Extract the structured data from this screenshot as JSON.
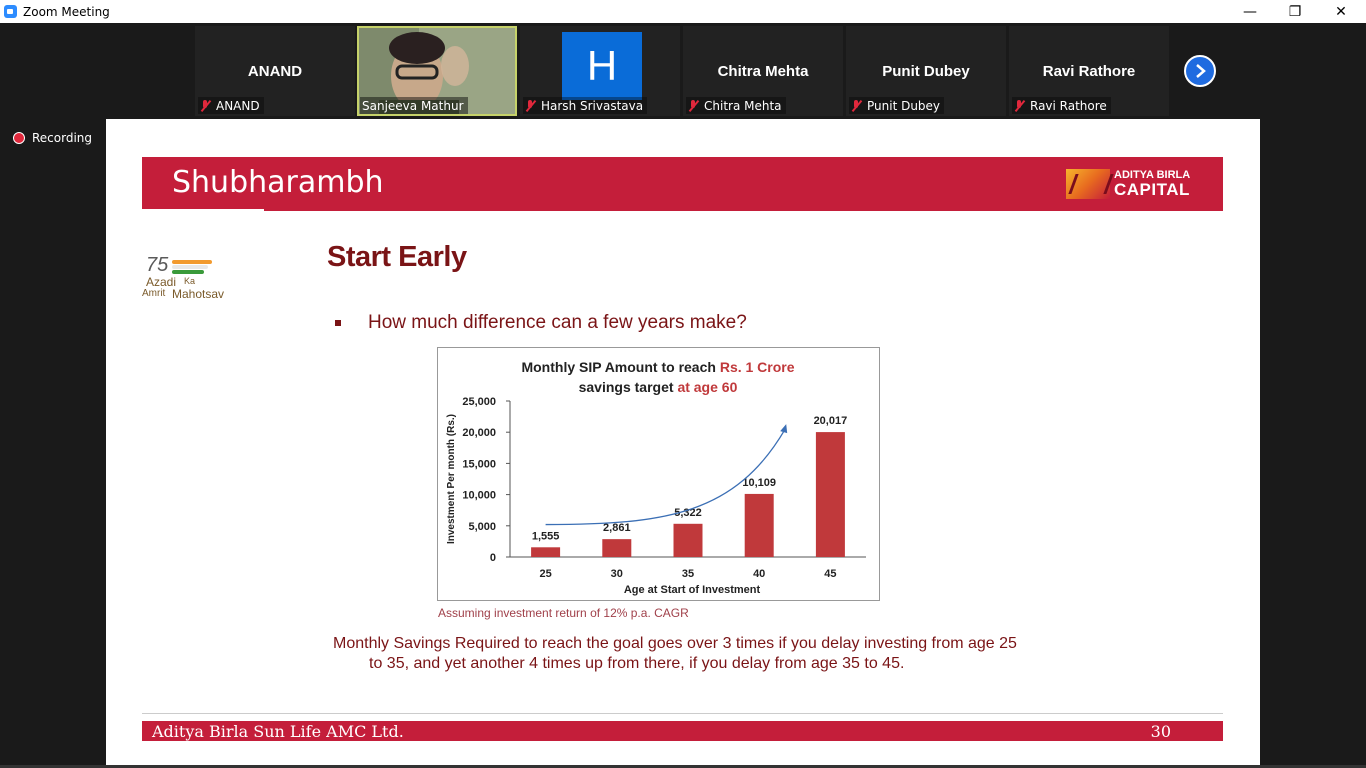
{
  "window": {
    "title": "Zoom Meeting",
    "minimize": "—",
    "restore": "❐",
    "close": "✕"
  },
  "participants": [
    {
      "name": "ANAND",
      "display": "ANAND",
      "type": "name"
    },
    {
      "name": "Sanjeeva Mathur",
      "display": "",
      "type": "video"
    },
    {
      "name": "Harsh Srivastava",
      "display": "H",
      "type": "avatar"
    },
    {
      "name": "Chitra Mehta",
      "display": "Chitra Mehta",
      "type": "name"
    },
    {
      "name": "Punit Dubey",
      "display": "Punit Dubey",
      "type": "name"
    },
    {
      "name": "Ravi Rathore",
      "display": "Ravi Rathore",
      "type": "name"
    }
  ],
  "recording": {
    "label": "Recording"
  },
  "slide": {
    "header_title": "Shubharambh",
    "logo_top": "ADITYA BIRLA",
    "logo_bottom": "CAPITAL",
    "azadi": {
      "n": "75",
      "line1": "Azadi",
      "ka": "Ka",
      "amrit": "Amrit",
      "mahotsav": "Mahotsav"
    },
    "heading": "Start Early",
    "bullet": "How much difference can a few years make?",
    "note": "Assuming investment return of 12% p.a. CAGR",
    "summary_line1": "Monthly Savings Required to reach the goal goes over 3 times if you delay investing from age 25",
    "summary_line2": "to 35, and yet another 4 times up from there, if you delay from age 35 to 45.",
    "footer_text": "Aditya Birla Sun Life AMC Ltd.",
    "page_number": "30"
  },
  "chart_data": {
    "type": "bar",
    "title_part1": "Monthly SIP Amount to reach ",
    "title_highlight1": "Rs. 1 Crore",
    "title_part2": "savings target ",
    "title_highlight2": "at age 60",
    "xlabel": "Age at Start of Investment",
    "ylabel": "Investment Per month (Rs.)",
    "categories": [
      "25",
      "30",
      "35",
      "40",
      "45"
    ],
    "values": [
      1555,
      2861,
      5322,
      10109,
      20017
    ],
    "value_labels": [
      "1,555",
      "2,861",
      "5,322",
      "10,109",
      "20,017"
    ],
    "yticks": [
      0,
      5000,
      10000,
      15000,
      20000,
      25000
    ],
    "ytick_labels": [
      "0",
      "5,000",
      "10,000",
      "15,000",
      "20,000",
      "25,000"
    ],
    "ylim": [
      0,
      25000
    ],
    "bar_color": "#c0393b",
    "highlight_color": "#c0393b",
    "trend_color": "#3b6fb5"
  },
  "colors": {
    "brand_red": "#c41e3a",
    "dark_red": "#7a1416",
    "zoom_blue": "#1f6be0"
  }
}
